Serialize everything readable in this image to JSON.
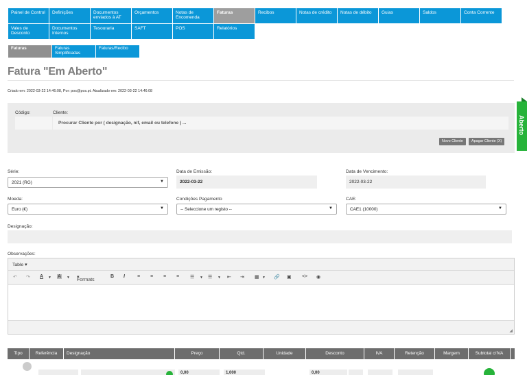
{
  "menu": [
    {
      "label": "Painel de Control",
      "active": false
    },
    {
      "label": "Definições",
      "active": false
    },
    {
      "label": "Documentos enviados à AT",
      "active": false
    },
    {
      "label": "Orçamentos",
      "active": false
    },
    {
      "label": "Notas de Encomenda",
      "active": false
    },
    {
      "label": "Faturas",
      "active": true
    },
    {
      "label": "Recibos",
      "active": false
    },
    {
      "label": "Notas de crédito",
      "active": false
    },
    {
      "label": "Notas de débito",
      "active": false
    },
    {
      "label": "Guias",
      "active": false
    },
    {
      "label": "Saldos",
      "active": false
    },
    {
      "label": "Conta Corrente",
      "active": false
    },
    {
      "label": "Vales de Desconto",
      "active": false
    },
    {
      "label": "Documentos Internos",
      "active": false
    },
    {
      "label": "Tesouraria",
      "active": false
    },
    {
      "label": "SAFT",
      "active": false
    },
    {
      "label": "POS",
      "active": false
    },
    {
      "label": "Relatórios",
      "active": false
    }
  ],
  "subtabs": [
    {
      "label": "Faturas",
      "active": true
    },
    {
      "label": "Faturas Simplificadas",
      "active": false
    },
    {
      "label": "Faturas/Recibo",
      "active": false
    }
  ],
  "page_title": "Fatura \"Em Aberto\"",
  "meta_line": "Criado em: 2022-03-22 14:46:08, Por: pos@pos.pt. Atualizado em: 2022-03-22 14:46:08",
  "client": {
    "code_label": "Código:",
    "client_label": "Cliente:",
    "search_placeholder": "Procurar Cliente por ( designação, nif, email ou telefone ) ...",
    "new_client": "Novo Cliente",
    "clear_client": "Apagar Cliente (X)"
  },
  "status_tab": "Aberto",
  "fields": {
    "serie_label": "Série:",
    "serie_value": "2021 (RG)",
    "emissao_label": "Data de Emissão:",
    "emissao_value": "2022-03-22",
    "vencimento_label": "Data de Vencimento:",
    "vencimento_value": "2022-03-22",
    "moeda_label": "Moeda:",
    "moeda_value": "Euro (€)",
    "condicoes_label": "Condições Pagamento",
    "condicoes_value": "-- Seleccione um registo --",
    "cae_label": "CAE:",
    "cae_value": "CAE1 (10000)",
    "designacao_label": "Designação:",
    "observacoes_label": "Observações:"
  },
  "editor": {
    "table_menu": "Table",
    "formats_menu": "Formats",
    "icons": [
      "undo-icon",
      "redo-icon",
      "font-color-icon",
      "background-color-icon",
      "bold-icon",
      "italic-icon",
      "align-left-icon",
      "align-center-icon",
      "align-right-icon",
      "justify-icon",
      "bullet-list-icon",
      "numbered-list-icon",
      "outdent-icon",
      "indent-icon",
      "table-icon",
      "link-icon",
      "image-icon",
      "code-icon",
      "preview-icon"
    ]
  },
  "table": {
    "headers": [
      "Tipo",
      "Referência",
      "Designação",
      "Preço",
      "Qtd.",
      "Unidade",
      "Desconto",
      "IVA",
      "Retenção",
      "Margem",
      "Subtotal c/IVA"
    ],
    "row": {
      "preco": "0,00",
      "qtd": "1,000",
      "desconto": "0,00"
    }
  },
  "colors": {
    "accent": "#0b97d8",
    "active_tab": "#9e9e9e",
    "status": "#27b33a",
    "table_header": "#6d6d6d"
  }
}
